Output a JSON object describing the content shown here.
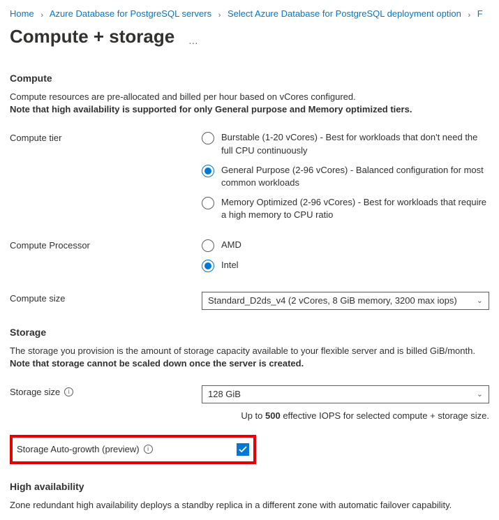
{
  "breadcrumb": {
    "home": "Home",
    "item2": "Azure Database for PostgreSQL servers",
    "item3": "Select Azure Database for PostgreSQL deployment option",
    "item4_trunc": "F"
  },
  "page": {
    "title": "Compute + storage",
    "more": "…"
  },
  "compute": {
    "heading": "Compute",
    "desc_line1": "Compute resources are pre-allocated and billed per hour based on vCores configured.",
    "desc_bold": "Note that high availability is supported for only General purpose and Memory optimized tiers.",
    "tier_label": "Compute tier",
    "tier_burstable": "Burstable (1-20 vCores) - Best for workloads that don't need the full CPU continuously",
    "tier_general": "General Purpose (2-96 vCores) - Balanced configuration for most common workloads",
    "tier_memory": "Memory Optimized (2-96 vCores) - Best for workloads that require a high memory to CPU ratio",
    "processor_label": "Compute Processor",
    "proc_amd": "AMD",
    "proc_intel": "Intel",
    "size_label": "Compute size",
    "size_value": "Standard_D2ds_v4 (2 vCores, 8 GiB memory, 3200 max iops)"
  },
  "storage": {
    "heading": "Storage",
    "desc_line1": "The storage you provision is the amount of storage capacity available to your flexible server and is billed GiB/month.",
    "desc_bold": "Note that storage cannot be scaled down once the server is created.",
    "size_label": "Storage size",
    "size_value": "128 GiB",
    "iops_pre": "Up to ",
    "iops_num": "500",
    "iops_post": " effective IOPS for selected compute + storage size.",
    "autogrowth_label": "Storage Auto-growth (preview)"
  },
  "ha": {
    "heading": "High availability",
    "desc": "Zone redundant high availability deploys a standby replica in a different zone with automatic failover capability."
  }
}
